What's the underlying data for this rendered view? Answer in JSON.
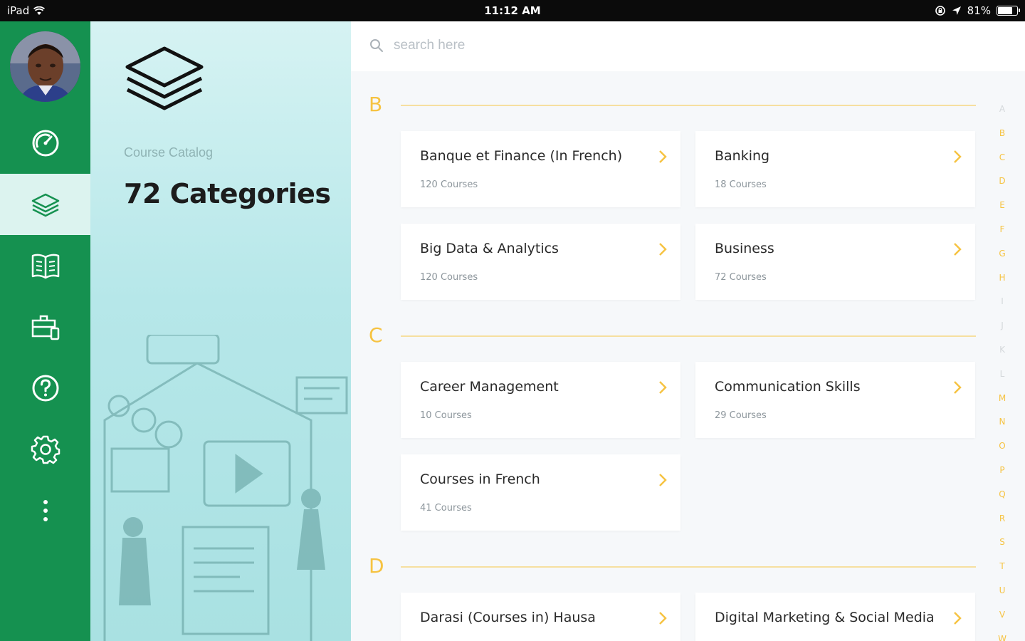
{
  "status": {
    "device": "iPad",
    "time": "11:12 AM",
    "battery": "81%",
    "battery_level": 0.81
  },
  "nav": {
    "items": [
      {
        "name": "dashboard-icon"
      },
      {
        "name": "catalog-layers-icon",
        "active": true
      },
      {
        "name": "book-icon"
      },
      {
        "name": "briefcase-icon"
      },
      {
        "name": "help-icon"
      },
      {
        "name": "settings-icon"
      },
      {
        "name": "more-vertical-icon"
      }
    ]
  },
  "panel": {
    "subtitle": "Course Catalog",
    "title": "72 Categories"
  },
  "search": {
    "placeholder": "search here"
  },
  "sections": [
    {
      "letter": "B",
      "cards": [
        {
          "name": "Banque et Finance (In French)",
          "count": "120 Courses"
        },
        {
          "name": "Banking",
          "count": "18 Courses"
        },
        {
          "name": "Big Data & Analytics",
          "count": "120 Courses"
        },
        {
          "name": "Business",
          "count": "72 Courses"
        }
      ]
    },
    {
      "letter": "C",
      "cards": [
        {
          "name": "Career Management",
          "count": "10 Courses"
        },
        {
          "name": "Communication Skills",
          "count": "29 Courses"
        },
        {
          "name": "Courses in French",
          "count": "41 Courses"
        }
      ]
    },
    {
      "letter": "D",
      "cards": [
        {
          "name": "Darasi (Courses in) Hausa",
          "count": ""
        },
        {
          "name": "Digital Marketing & Social Media",
          "count": ""
        }
      ]
    }
  ],
  "alphabet": {
    "letters": [
      "A",
      "B",
      "C",
      "D",
      "E",
      "F",
      "G",
      "H",
      "I",
      "J",
      "K",
      "L",
      "M",
      "N",
      "O",
      "P",
      "Q",
      "R",
      "S",
      "T",
      "U",
      "V",
      "W"
    ],
    "active_color": "#f6c342",
    "inactive_color": "#d4d8db",
    "inactive": [
      "A",
      "I",
      "J",
      "K",
      "L"
    ]
  },
  "colors": {
    "brand_green": "#159150",
    "accent_yellow": "#f6c342"
  }
}
